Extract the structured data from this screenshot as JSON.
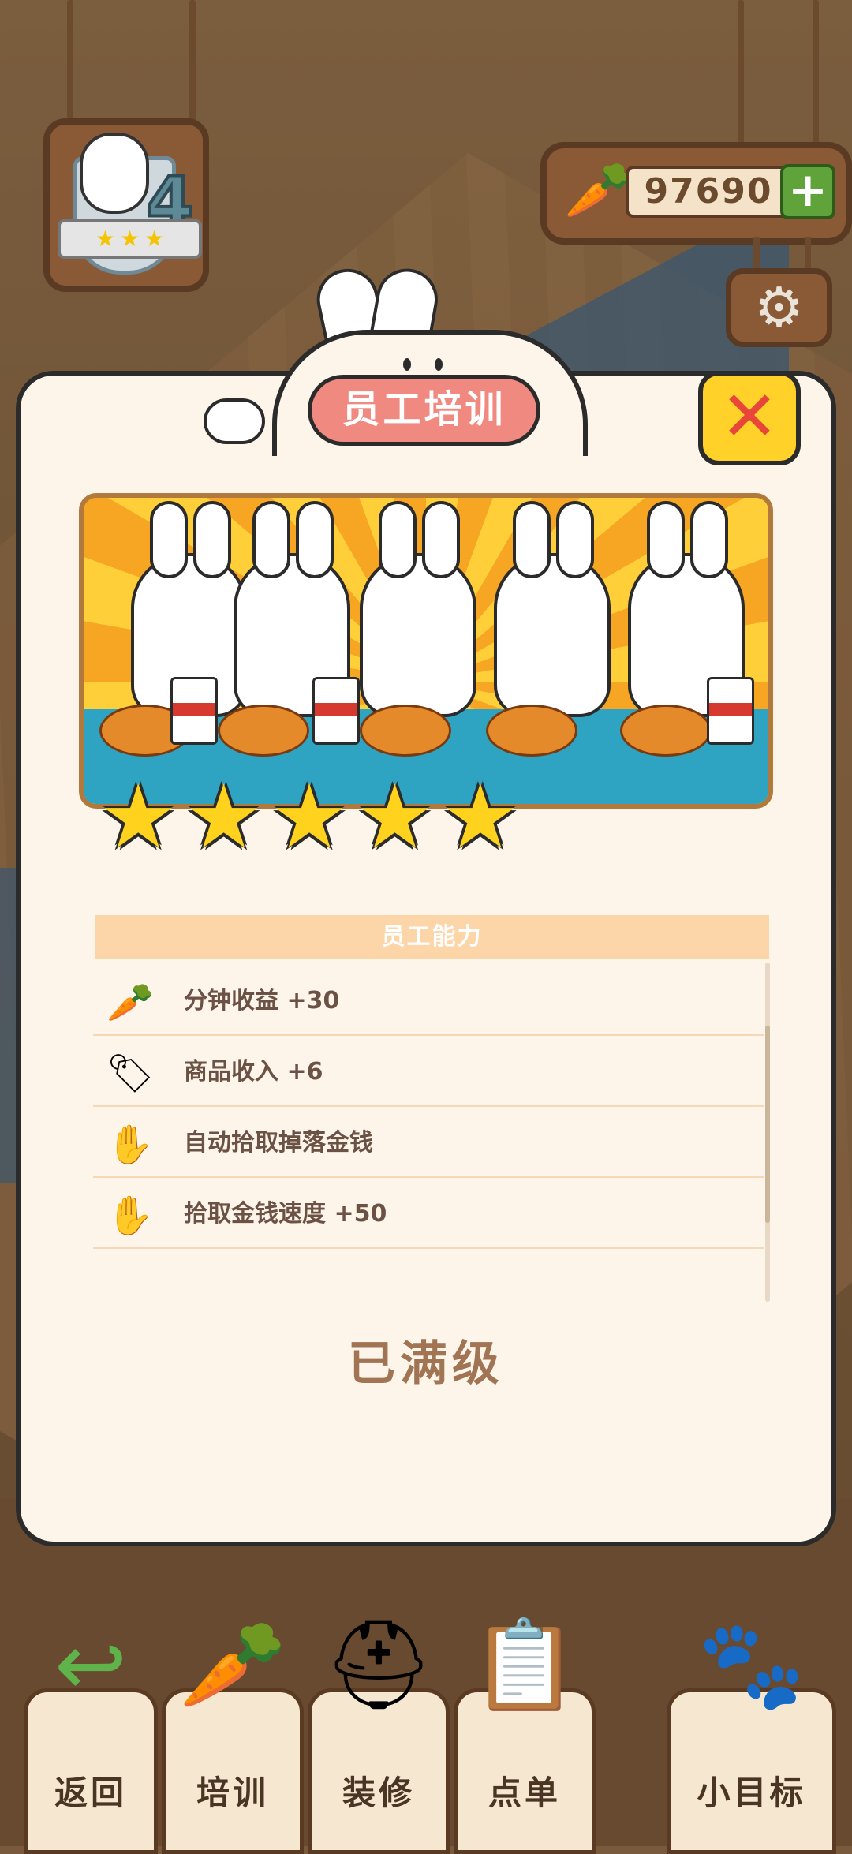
{
  "hud": {
    "level": "4",
    "level_stars": [
      "★",
      "★",
      "★"
    ],
    "currency_value": "97690",
    "currency_plus": "+",
    "settings_icon": "gear-icon"
  },
  "modal": {
    "title": "员工培训",
    "close_label": "✕",
    "banner_alt_icon": "staff-bunnies-eating-illustration",
    "stars": [
      "★",
      "★",
      "★",
      "★",
      "★"
    ],
    "abilities_header": "员工能力",
    "abilities": [
      {
        "label": "分钟收益 +30",
        "icon": "carrot-clock-icon"
      },
      {
        "label": "商品收入 +6",
        "icon": "price-tag-up-icon"
      },
      {
        "label": "自动拾取掉落金钱",
        "icon": "glove-hand-icon"
      },
      {
        "label": "拾取金钱速度 +50",
        "icon": "glove-hand-icon"
      }
    ],
    "max_level_text": "已满级"
  },
  "nav": {
    "items": [
      {
        "label": "返回",
        "icon": "back-arrow-icon"
      },
      {
        "label": "培训",
        "icon": "carrot-medal-icon"
      },
      {
        "label": "装修",
        "icon": "hardhat-bunny-icon"
      },
      {
        "label": "点单",
        "icon": "clipboard-order-icon"
      },
      {
        "label": "小目标",
        "icon": "paw-flag-icon"
      }
    ]
  },
  "colors": {
    "title_pill": "#f08a80",
    "close_button": "#ffd129",
    "close_x": "#e8463a",
    "star": "#ffd21e",
    "abilities_header_bg": "#fcd6a8",
    "max_level_text": "#a17454"
  }
}
